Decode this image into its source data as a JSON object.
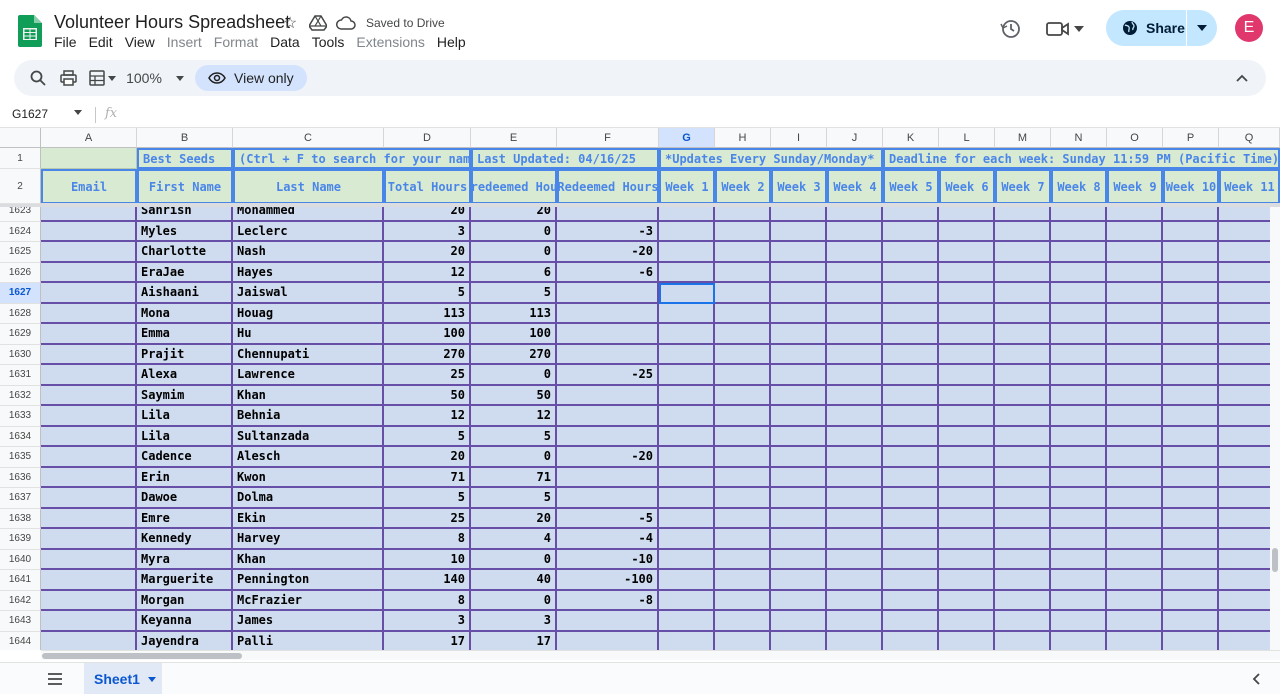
{
  "document": {
    "title": "Volunteer Hours Spreadsheet",
    "saved_status": "Saved to Drive"
  },
  "menu": [
    "File",
    "Edit",
    "View",
    "Insert",
    "Format",
    "Data",
    "Tools",
    "Extensions",
    "Help"
  ],
  "menu_disabled": [
    "Insert",
    "Format",
    "Extensions"
  ],
  "header": {
    "share_label": "Share",
    "avatar_initial": "E",
    "avatar_color": "#e0376d"
  },
  "toolbar": {
    "zoom": "100%",
    "view_only_label": "View only"
  },
  "formula_bar": {
    "name_box": "G1627",
    "fx_label": "fx"
  },
  "columns": [
    "A",
    "B",
    "C",
    "D",
    "E",
    "F",
    "G",
    "H",
    "I",
    "J",
    "K",
    "L",
    "M",
    "N",
    "O",
    "P",
    "Q"
  ],
  "selected_column": "G",
  "frozen_rows": {
    "row1": {
      "number": "1",
      "cells": {
        "A": "",
        "B": "Best Seeds",
        "C": "(Ctrl + F to search for your name)",
        "E": "Last Updated: 04/16/25",
        "G": "*Updates Every Sunday/Monday*",
        "K": "Deadline for each week: Sunday 11:59 PM (Pacific Time)"
      }
    },
    "row2": {
      "number": "2",
      "headers": [
        "Email",
        "First Name",
        "Last Name",
        "Total Hours",
        "Unredeemed Hours",
        "Redeemed Hours",
        "Week 1",
        "Week 2",
        "Week 3",
        "Week 4",
        "Week 5",
        "Week 6",
        "Week 7",
        "Week 8",
        "Week 9",
        "Week 10",
        "Week 11"
      ]
    }
  },
  "rows": [
    {
      "row": "1623",
      "first": "Sahrish",
      "last": "Mohammed",
      "total": "20",
      "unredeemed": "20",
      "redeemed": ""
    },
    {
      "row": "1624",
      "first": "Myles",
      "last": "Leclerc",
      "total": "3",
      "unredeemed": "0",
      "redeemed": "-3"
    },
    {
      "row": "1625",
      "first": "Charlotte",
      "last": "Nash",
      "total": "20",
      "unredeemed": "0",
      "redeemed": "-20"
    },
    {
      "row": "1626",
      "first": "EraJae",
      "last": "Hayes",
      "total": "12",
      "unredeemed": "6",
      "redeemed": "-6"
    },
    {
      "row": "1627",
      "first": "Aishaani",
      "last": "Jaiswal",
      "total": "5",
      "unredeemed": "5",
      "redeemed": ""
    },
    {
      "row": "1628",
      "first": "Mona",
      "last": "Houag",
      "total": "113",
      "unredeemed": "113",
      "redeemed": ""
    },
    {
      "row": "1629",
      "first": "Emma",
      "last": "Hu",
      "total": "100",
      "unredeemed": "100",
      "redeemed": ""
    },
    {
      "row": "1630",
      "first": "Prajit",
      "last": "Chennupati",
      "total": "270",
      "unredeemed": "270",
      "redeemed": ""
    },
    {
      "row": "1631",
      "first": "Alexa",
      "last": "Lawrence",
      "total": "25",
      "unredeemed": "0",
      "redeemed": "-25"
    },
    {
      "row": "1632",
      "first": "Saymim",
      "last": "Khan",
      "total": "50",
      "unredeemed": "50",
      "redeemed": ""
    },
    {
      "row": "1633",
      "first": "Lila",
      "last": "Behnia",
      "total": "12",
      "unredeemed": "12",
      "redeemed": ""
    },
    {
      "row": "1634",
      "first": "Lila",
      "last": "Sultanzada",
      "total": "5",
      "unredeemed": "5",
      "redeemed": ""
    },
    {
      "row": "1635",
      "first": "Cadence",
      "last": "Alesch",
      "total": "20",
      "unredeemed": "0",
      "redeemed": "-20"
    },
    {
      "row": "1636",
      "first": "Erin",
      "last": "Kwon",
      "total": "71",
      "unredeemed": "71",
      "redeemed": ""
    },
    {
      "row": "1637",
      "first": "Dawoe",
      "last": "Dolma",
      "total": "5",
      "unredeemed": "5",
      "redeemed": ""
    },
    {
      "row": "1638",
      "first": "Emre",
      "last": "Ekin",
      "total": "25",
      "unredeemed": "20",
      "redeemed": "-5"
    },
    {
      "row": "1639",
      "first": "Kennedy",
      "last": "Harvey",
      "total": "8",
      "unredeemed": "4",
      "redeemed": "-4"
    },
    {
      "row": "1640",
      "first": "Myra",
      "last": "Khan",
      "total": "10",
      "unredeemed": "0",
      "redeemed": "-10"
    },
    {
      "row": "1641",
      "first": "Marguerite",
      "last": "Pennington",
      "total": "140",
      "unredeemed": "40",
      "redeemed": "-100"
    },
    {
      "row": "1642",
      "first": "Morgan",
      "last": "McFrazier",
      "total": "8",
      "unredeemed": "0",
      "redeemed": "-8"
    },
    {
      "row": "1643",
      "first": "Keyanna",
      "last": "James",
      "total": "3",
      "unredeemed": "3",
      "redeemed": ""
    },
    {
      "row": "1644",
      "first": "Jayendra",
      "last": "Palli",
      "total": "17",
      "unredeemed": "17",
      "redeemed": ""
    }
  ],
  "active_cell": {
    "row": "1627",
    "col": "G"
  },
  "sheet_tabs": [
    {
      "name": "Sheet1",
      "active": true
    }
  ],
  "colors": {
    "frozen_fill": "#d9ead3",
    "frozen_text": "#4a86e8",
    "body_fill": "#cfdcef",
    "border": "#674ea7",
    "accent": "#0b57d0"
  }
}
